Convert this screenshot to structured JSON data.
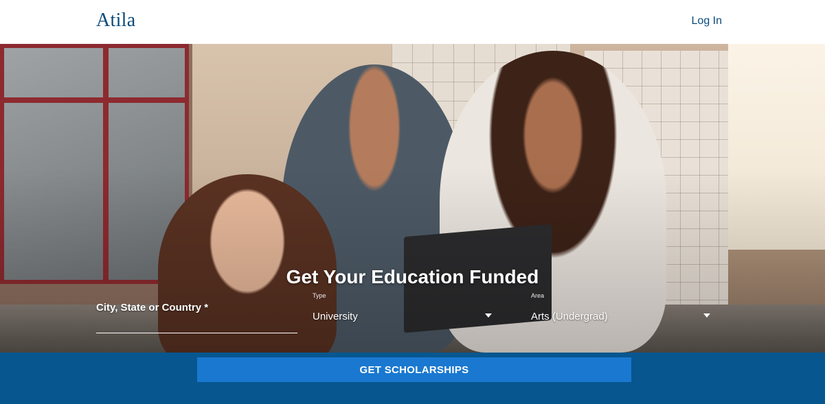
{
  "header": {
    "logo": "Atila",
    "login_label": "Log In"
  },
  "hero": {
    "headline": "Get Your Education Funded"
  },
  "search": {
    "city_label": "City, State or Country *",
    "type_label": "Type",
    "type_value": "University",
    "area_label": "Area",
    "area_value": "Arts (Undergrad)",
    "submit_label": "GET SCHOLARSHIPS"
  },
  "colors": {
    "brand": "#0b4a7b",
    "bottom_bar": "#07568f",
    "cta": "#1a78d0"
  },
  "icons": {
    "type_dropdown": "chevron-down-icon",
    "area_dropdown": "chevron-down-icon"
  }
}
